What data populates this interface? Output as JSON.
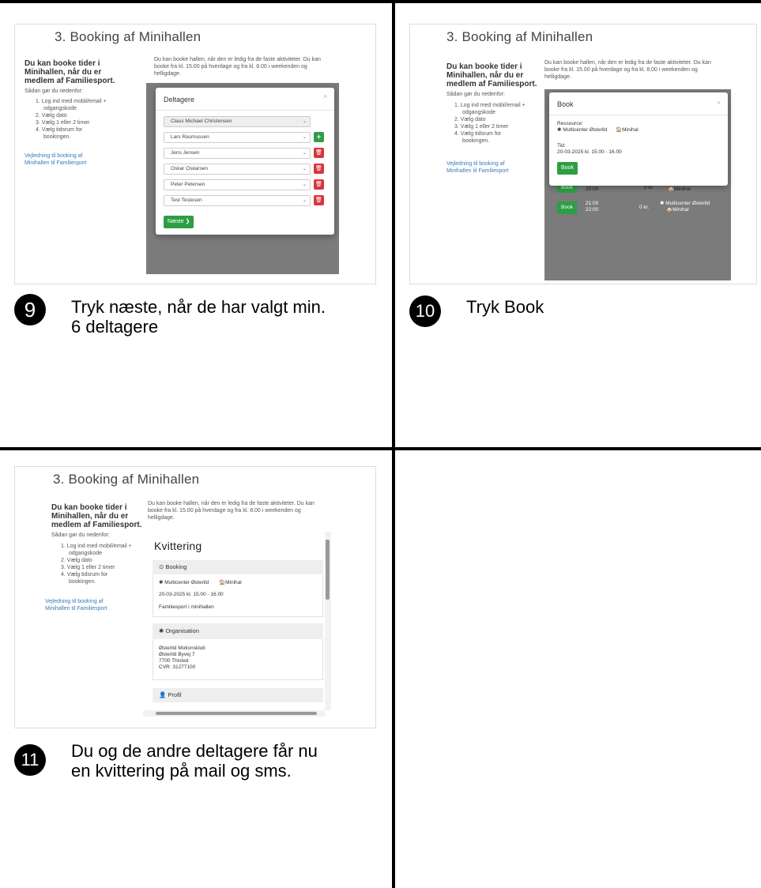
{
  "shared": {
    "title": "3. Booking af Minihallen",
    "lead": [
      "Du kan booke tider i",
      "Minihallen, når du er",
      "medlem af Familiesport."
    ],
    "howto": "Sådan gør du nedenfor:",
    "steps": [
      "1. Log ind med mobil/email +",
      "odgangskode",
      "2. Vælg dato",
      "3. Vælg 1 eller 2 timer",
      "4. Vælg tidsrum for",
      "bookingen."
    ],
    "guide_link": [
      "Vejledning til booking af",
      "Minihallen til Familiesport"
    ],
    "info": [
      "Du kan booke hallen, når den er ledig fra de faste aktiviteter. Du kan",
      "booke fra kl. 15.00 på hverdage og fra kl. 8.00 i weekenden og",
      "helligdage."
    ]
  },
  "step9": {
    "number": "9",
    "caption": [
      "Tryk næste, når de har valgt min.",
      "6 deltagere"
    ],
    "modal": {
      "title": "Deltagere",
      "close": "×",
      "participants": [
        "Claus Michael Christensen",
        "Lars Rasmussen",
        "Jens Jensen",
        "Oskar Oskarsen",
        "Peter Petersen",
        "Test Testesen"
      ],
      "next_label": "Næste ❯"
    }
  },
  "step10": {
    "number": "10",
    "caption": "Tryk Book",
    "modal": {
      "title": "Book",
      "close": "×",
      "resource_label": "Ressource:",
      "resource_place": "✱ Multicenter Østerild",
      "resource_hall": "🏠Minihal",
      "time_label": "Tid:",
      "time_value": "20-03-2025 kl. 15.00 - 16.00",
      "book_label": "Book"
    },
    "rows": [
      {
        "btn": "Book",
        "time": "20:00",
        "price": "0 kr.",
        "hall": "🏠Minihal"
      },
      {
        "btn": "Book",
        "time": "21:00",
        "time2": "22:00",
        "price": "0 kr.",
        "place": "✱ Multicenter Østerild",
        "hall": "🏠Minihal"
      }
    ]
  },
  "step11": {
    "number": "11",
    "caption": [
      "Du og de andre deltagere får nu",
      "en kvittering på mail og sms."
    ],
    "receipt": {
      "title": "Kvittering",
      "booking_header": "⊙ Booking",
      "booking_place": "✱ Multicenter Østerild",
      "booking_hall": "🏠Minihal",
      "booking_time": "20-03-2025 kl. 15.00 - 16.00",
      "booking_activity": "Familiesport i minihallen",
      "org_header": "✱ Organisation",
      "org_lines": [
        "Østerild Motionsklub",
        "Østerild Byvej 7",
        "7700 Thisted",
        "CVR: 31277100"
      ],
      "profile_header": "👤 Profil"
    }
  }
}
